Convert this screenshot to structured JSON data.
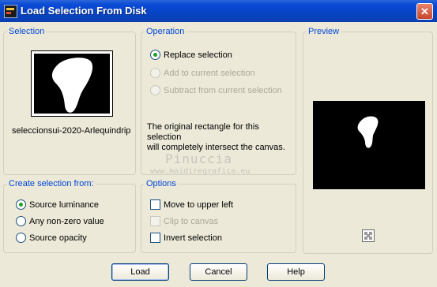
{
  "window": {
    "title": "Load Selection From Disk",
    "close_glyph": "✕"
  },
  "selection": {
    "group_label": "Selection",
    "name": "seleccionsui-2020-Arlequindrip"
  },
  "operation": {
    "group_label": "Operation",
    "options": [
      {
        "label": "Replace selection",
        "checked": true,
        "enabled": true
      },
      {
        "label": "Add to current selection",
        "checked": false,
        "enabled": false
      },
      {
        "label": "Subtract from current selection",
        "checked": false,
        "enabled": false
      }
    ],
    "info_line1": "The original rectangle for this selection",
    "info_line2": "will completely intersect the canvas."
  },
  "preview": {
    "group_label": "Preview"
  },
  "create_from": {
    "group_label": "Create selection from:",
    "options": [
      {
        "label": "Source luminance",
        "checked": true
      },
      {
        "label": "Any non-zero value",
        "checked": false
      },
      {
        "label": "Source opacity",
        "checked": false
      }
    ]
  },
  "options": {
    "group_label": "Options",
    "items": [
      {
        "label": "Move to upper left",
        "checked": false,
        "enabled": true
      },
      {
        "label": "Clip to canvas",
        "checked": false,
        "enabled": false
      },
      {
        "label": "Invert selection",
        "checked": false,
        "enabled": true
      }
    ]
  },
  "watermark": {
    "line1": "Pinuccia",
    "line2": "www.maidiregrafica.eu"
  },
  "buttons": {
    "load": "Load",
    "cancel": "Cancel",
    "help": "Help"
  },
  "colors": {
    "titlebar": "#0a4bd6",
    "dialog_bg": "#ece9d8",
    "group_label": "#0046d5",
    "radio_dot": "#21a121"
  }
}
